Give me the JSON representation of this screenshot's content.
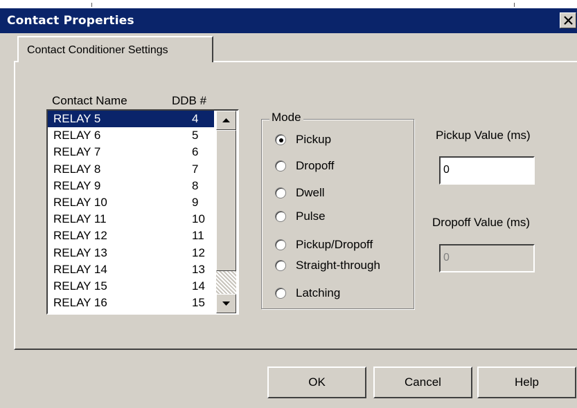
{
  "window": {
    "title": "Contact Properties",
    "close_symbol": "✕",
    "colors": {
      "titlebar": "#0a246a",
      "face": "#d4d0c8",
      "selection": "#0a246a"
    }
  },
  "tab": {
    "label": "Contact Conditioner Settings"
  },
  "contacts": {
    "headers": {
      "name": "Contact Name",
      "ddb": "DDB #"
    },
    "rows": [
      {
        "name": "RELAY 5",
        "ddb": "4",
        "selected": true
      },
      {
        "name": "RELAY 6",
        "ddb": "5"
      },
      {
        "name": "RELAY 7",
        "ddb": "6"
      },
      {
        "name": "RELAY 8",
        "ddb": "7"
      },
      {
        "name": "RELAY 9",
        "ddb": "8"
      },
      {
        "name": "RELAY 10",
        "ddb": "9"
      },
      {
        "name": "RELAY 11",
        "ddb": "10"
      },
      {
        "name": "RELAY 12",
        "ddb": "11"
      },
      {
        "name": "RELAY 13",
        "ddb": "12"
      },
      {
        "name": "RELAY 14",
        "ddb": "13"
      },
      {
        "name": "RELAY 15",
        "ddb": "14"
      },
      {
        "name": "RELAY 16",
        "ddb": "15"
      }
    ]
  },
  "mode": {
    "label": "Mode",
    "selected": "Pickup",
    "options": [
      "Pickup",
      "Dropoff",
      "Dwell",
      "Pulse",
      "Pickup/Dropoff",
      "Straight-through",
      "Latching"
    ]
  },
  "pickup": {
    "label": "Pickup Value (ms)",
    "value": "0"
  },
  "dropoff": {
    "label": "Dropoff Value (ms)",
    "value": "0",
    "disabled": true
  },
  "buttons": {
    "ok": "OK",
    "cancel": "Cancel",
    "help": "Help"
  }
}
